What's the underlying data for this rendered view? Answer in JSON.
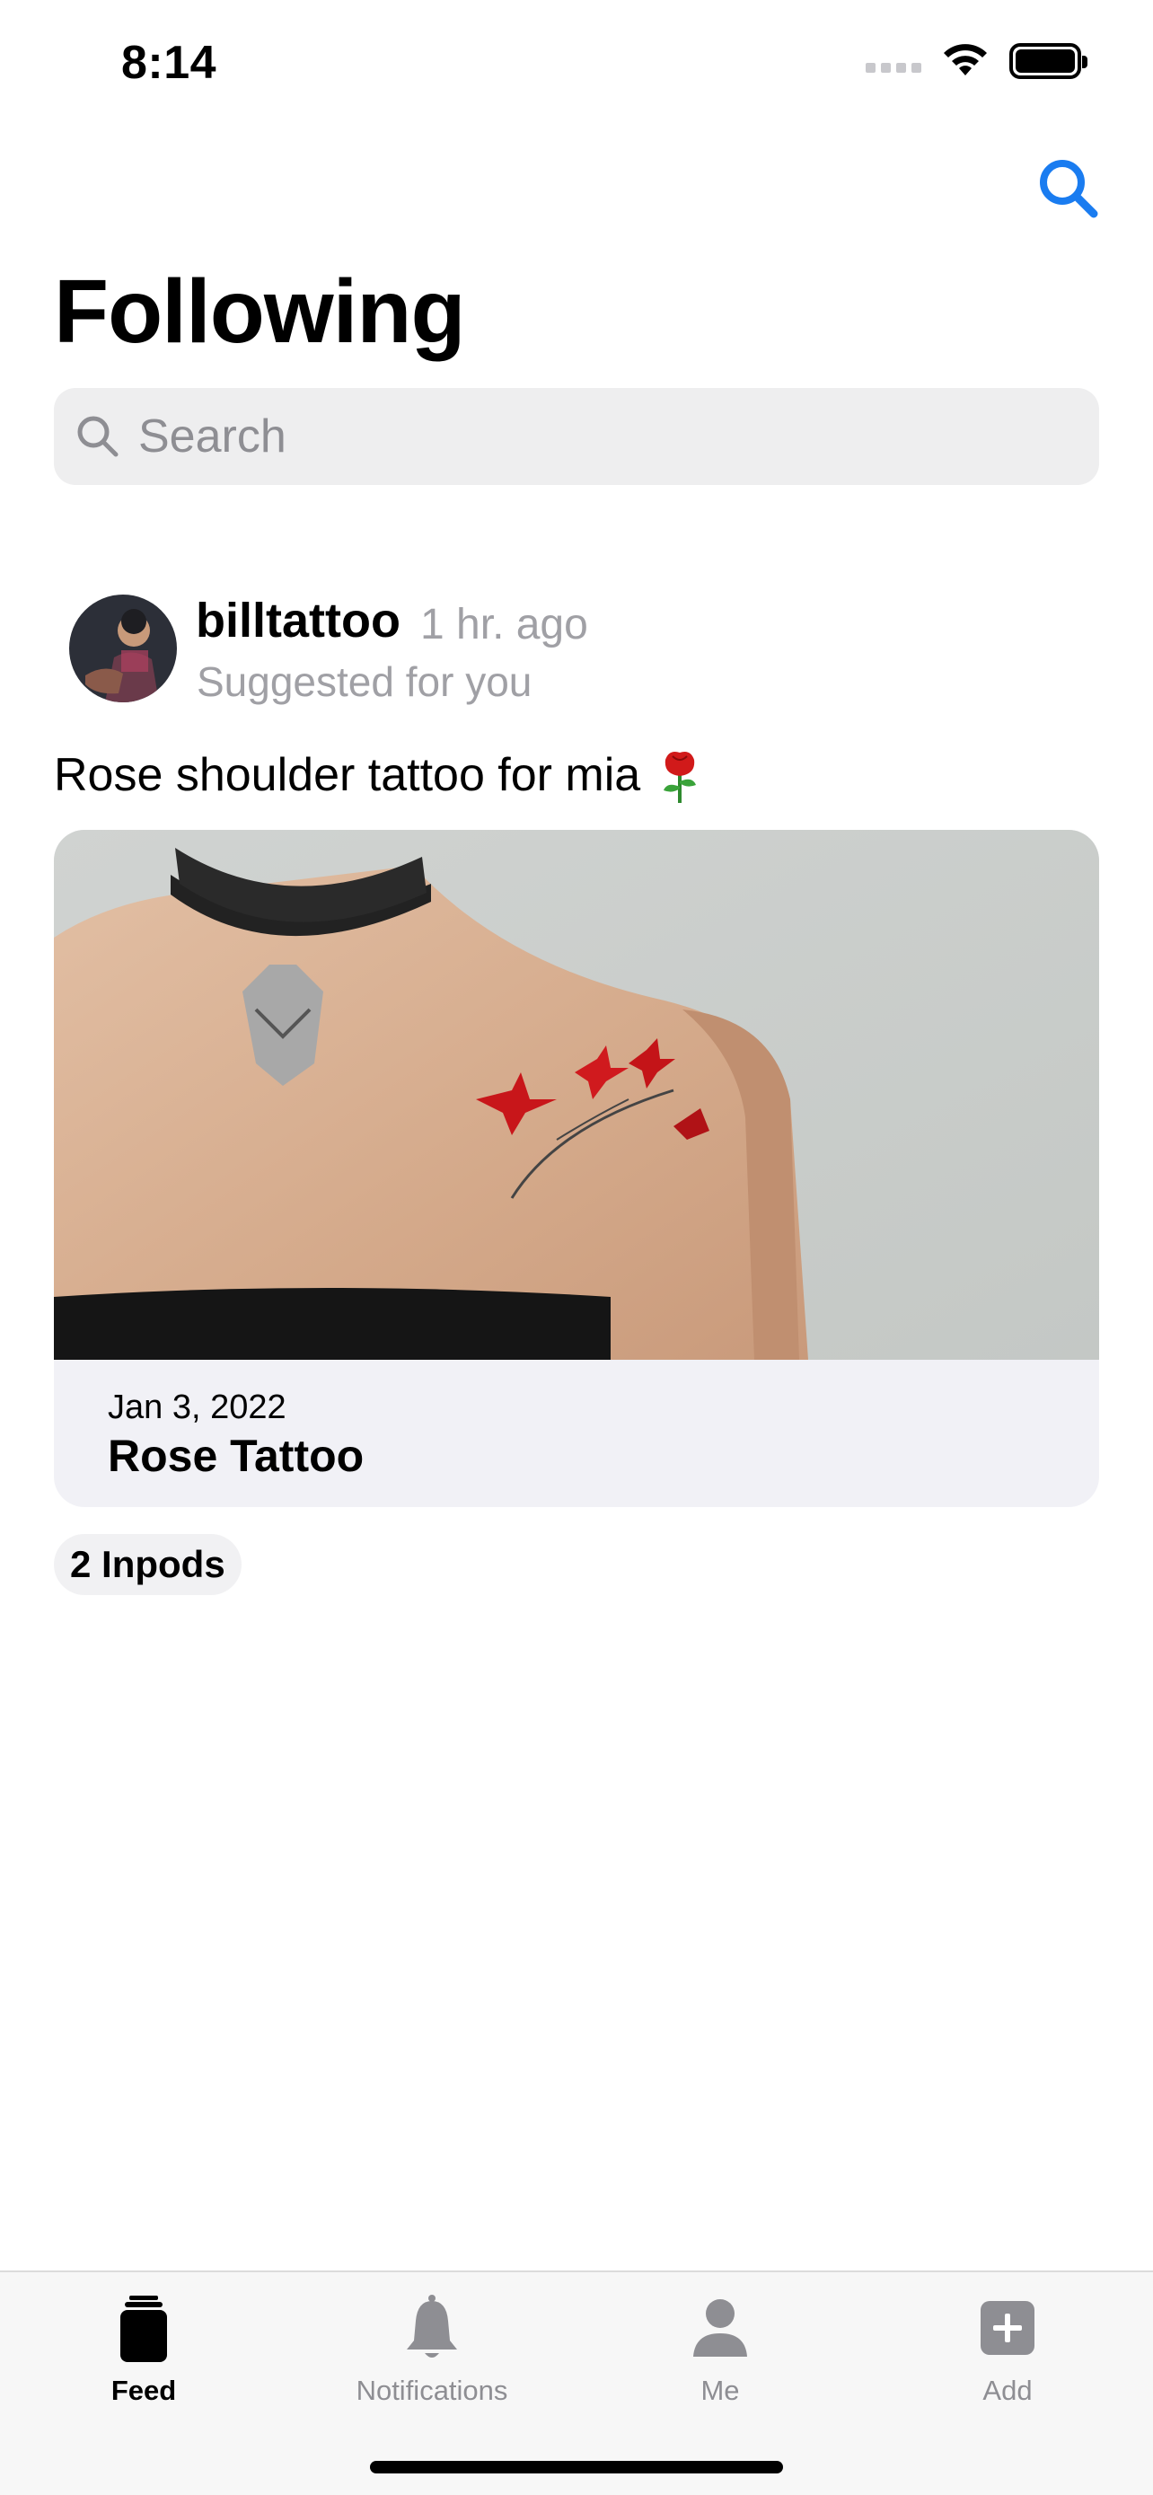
{
  "status_bar": {
    "time": "8:14"
  },
  "header": {
    "title": "Following",
    "search_icon": "search-icon"
  },
  "search": {
    "placeholder": "Search"
  },
  "post": {
    "username": "billtattoo",
    "time_ago": "1 hr. ago",
    "subtitle": "Suggested for you",
    "caption": "Rose shoulder tattoo for mia",
    "caption_emoji": "rose",
    "card": {
      "date": "Jan 3, 2022",
      "title": "Rose Tattoo"
    },
    "inpods": "2 Inpods"
  },
  "tabbar": {
    "items": [
      {
        "label": "Feed",
        "icon": "feed-icon",
        "active": true
      },
      {
        "label": "Notifications",
        "icon": "bell-icon",
        "active": false
      },
      {
        "label": "Me",
        "icon": "person-icon",
        "active": false
      },
      {
        "label": "Add",
        "icon": "plus-square-icon",
        "active": false
      }
    ]
  },
  "colors": {
    "accent": "#1a7cf0",
    "secondary_text": "#a0a0a5",
    "card_bg": "#f1f1f6"
  }
}
